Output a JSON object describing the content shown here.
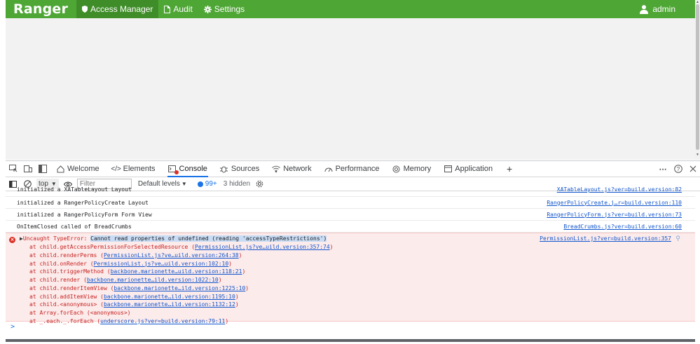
{
  "app": {
    "brand": "Ranger",
    "nav": [
      {
        "label": "Access Manager",
        "icon": "shield-icon",
        "active": true
      },
      {
        "label": "Audit",
        "icon": "file-icon",
        "active": false
      },
      {
        "label": "Settings",
        "icon": "gear-icon",
        "active": false
      }
    ],
    "user": {
      "label": "admin",
      "icon": "user-icon"
    },
    "accent": "#4ea635"
  },
  "devtools": {
    "tabs": [
      {
        "label": "Welcome",
        "icon": "home-icon"
      },
      {
        "label": "Elements",
        "icon": "code-icon"
      },
      {
        "label": "Console",
        "icon": "console-icon",
        "active": true
      },
      {
        "label": "Sources",
        "icon": "bug-icon"
      },
      {
        "label": "Network",
        "icon": "wifi-icon"
      },
      {
        "label": "Performance",
        "icon": "gauge-icon"
      },
      {
        "label": "Memory",
        "icon": "memory-icon"
      },
      {
        "label": "Application",
        "icon": "window-icon"
      }
    ],
    "toolbar": {
      "context": "top",
      "filter_placeholder": "Filter",
      "levels": "Default levels",
      "issues": "99+",
      "hidden": "3 hidden"
    },
    "logs": [
      {
        "msg": "initialized a XATableLayout Layout",
        "src": "XATableLayout.js?ver=build.version:82"
      },
      {
        "msg": "initialized a RangerPolicyCreate Layout",
        "src": "RangerPolicyCreate.j…r=build.version:110"
      },
      {
        "msg": "initialized a RangerPolicyForm Form View",
        "src": "RangerPolicyForm.js?ver=build.version:73"
      },
      {
        "msg": "OnItemClosed called of BreadCrumbs",
        "src": "BreadCrumbs.js?ver=build.version:60"
      }
    ],
    "error": {
      "prefix": "Uncaught TypeError: ",
      "highlight": "Cannot read properties of undefined (reading 'accessTypeRestrictions')",
      "src": "PermissionList.js?ver=build.version:357",
      "stack": [
        {
          "pre": "at child.getAccessPermissionForSelectedResource (",
          "link": "PermissionList.js?ve…uild.version:357:74",
          "post": ")"
        },
        {
          "pre": "at child.renderPerms (",
          "link": "PermissionList.js?ve…uild.version:264:38",
          "post": ")"
        },
        {
          "pre": "at child.onRender (",
          "link": "PermissionList.js?ve…uild.version:102:10",
          "post": ")"
        },
        {
          "pre": "at child.triggerMethod (",
          "link": "backbone.marionette…uild.version:118:21",
          "post": ")"
        },
        {
          "pre": "at child.render (",
          "link": "backbone.marionette…ild.version:1022:10",
          "post": ")"
        },
        {
          "pre": "at child.renderItemView (",
          "link": "backbone.marionette…ild.version:1225:10",
          "post": ")"
        },
        {
          "pre": "at child.addItemView (",
          "link": "backbone.marionette…ild.version:1195:10",
          "post": ")"
        },
        {
          "pre": "at child.<anonymous> (",
          "link": "backbone.marionette…ild.version:1132:12",
          "post": ")"
        },
        {
          "pre": "at Array.forEach (<anonymous>)",
          "link": "",
          "post": ""
        },
        {
          "pre": "at _.each._.forEach (",
          "link": "underscore.js?ver=build.version:79:11",
          "post": ")"
        }
      ]
    },
    "prompt": ">"
  }
}
